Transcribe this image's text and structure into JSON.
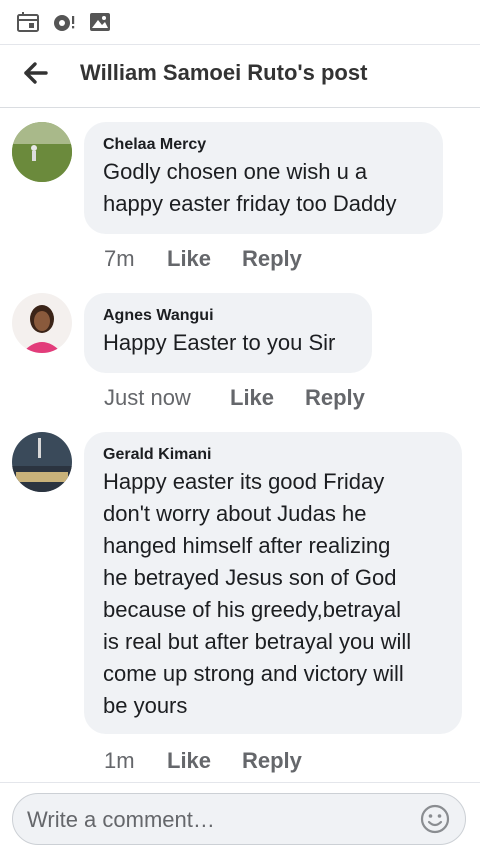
{
  "status_bar": {
    "icons": [
      "calendar-icon",
      "media-notification-icon",
      "image-icon"
    ]
  },
  "header": {
    "title": "William Samoei Ruto's post",
    "back_icon": "arrow-left-icon"
  },
  "comments": [
    {
      "author": "Chelaa Mercy",
      "lines": [
        "Godly chosen one wish u a",
        "happy easter friday too Daddy"
      ],
      "time": "7m",
      "like_label": "Like",
      "reply_label": "Reply"
    },
    {
      "author": "Agnes Wangui",
      "lines": [
        "Happy Easter to you Sir"
      ],
      "time": "Just now",
      "like_label": "Like",
      "reply_label": "Reply"
    },
    {
      "author": "Gerald Kimani",
      "lines": [
        "Happy easter its good Friday",
        "don't worry about Judas he",
        "hanged himself after realizing",
        "he betrayed Jesus son of God",
        "because of his greedy,betrayal",
        "is real but after betrayal you will",
        "come up strong and victory will",
        "be yours"
      ],
      "time": "1m",
      "like_label": "Like",
      "reply_label": "Reply"
    }
  ],
  "composer": {
    "placeholder": "Write a comment…",
    "emoji_icon": "smiley-icon"
  },
  "colors": {
    "bubble": "#f0f2f5",
    "meta_text": "#65676b",
    "title_text": "#333333"
  }
}
